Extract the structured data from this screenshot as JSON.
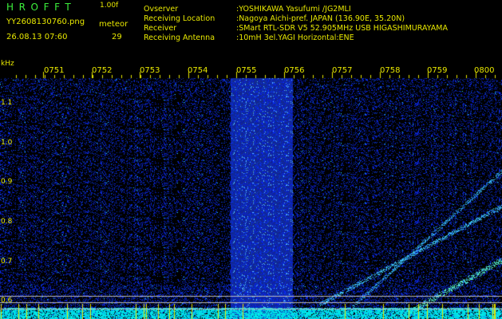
{
  "header": {
    "app_name": "HROFFT",
    "app_version": "1.00f",
    "file_name": "YY2608130760.png",
    "capture_time": "26.08.13 07:60",
    "meteor_label": "meteor",
    "meteor_count": "29",
    "info": [
      {
        "label": "Ovserver",
        "value": ":YOSHIKAWA Yasufumi /JG2MLI"
      },
      {
        "label": "Receiving Location",
        "value": ":Nagoya Aichi-pref. JAPAN (136.90E, 35.20N)"
      },
      {
        "label": "Receiver",
        "value": ":SMart RTL-SDR V5 52.905MHz USB HIGASHIMURAYAMA"
      },
      {
        "label": "Receiving Antenna",
        "value": ":10mH 3el.YAGI Horizontal:ENE"
      }
    ]
  },
  "plot": {
    "y_unit": "kHz",
    "y_ticks": [
      "1.1",
      "1.0",
      "0.9",
      "0.8",
      "0.7",
      "0.6"
    ],
    "x_ticks": [
      "0751",
      "0752",
      "0753",
      "0754",
      "0755",
      "0756",
      "0757",
      "0758",
      "0759",
      "0800"
    ],
    "colors": {
      "background": "#000000",
      "text": "#e8e800",
      "title": "#3cf03c",
      "noise": "#1a2ad6",
      "signal": "#00e0ff"
    }
  }
}
